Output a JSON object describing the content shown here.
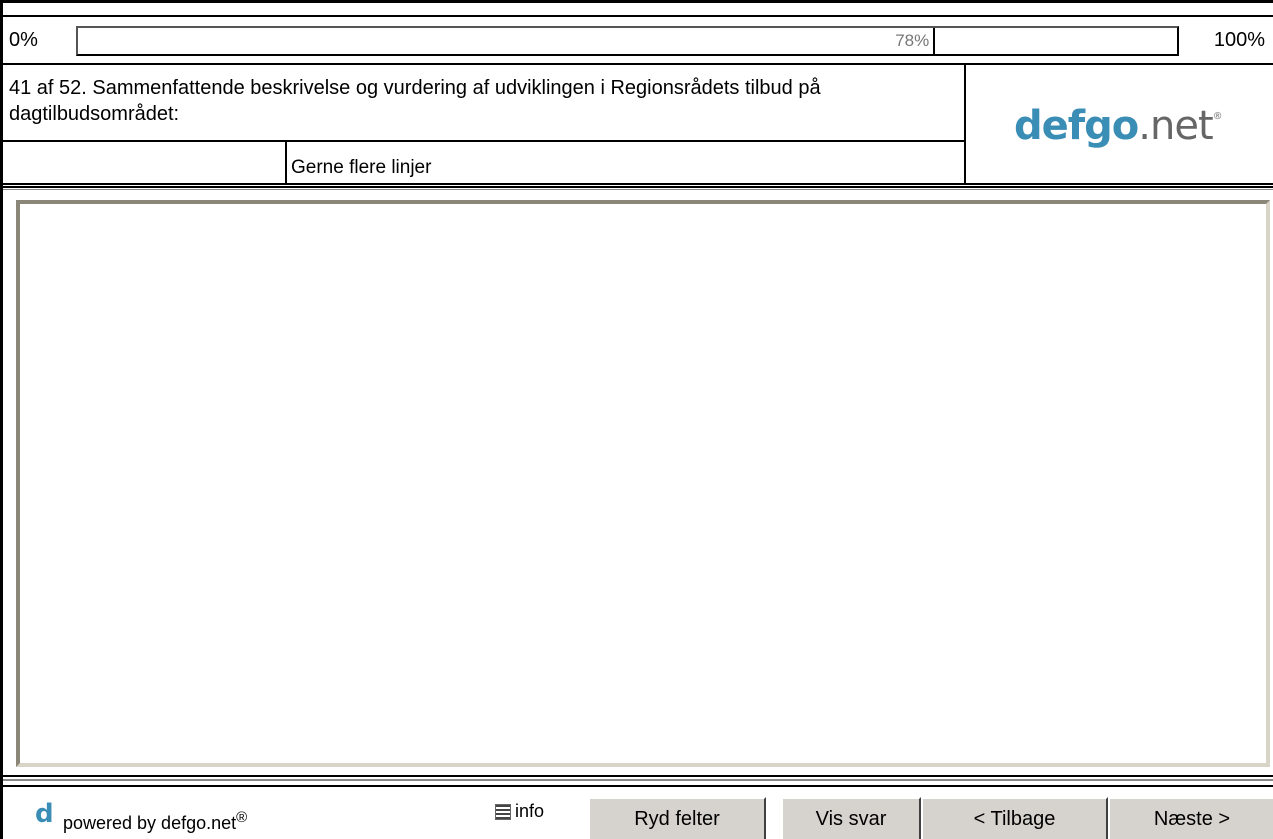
{
  "progress": {
    "start_label": "0%",
    "end_label": "100%",
    "value_label": "78%",
    "fraction": 0.78
  },
  "question": {
    "text": "41 af 52. Sammenfattende beskrivelse og vurdering af udviklingen i Regionsrådets tilbud på dagtilbudsområdet:",
    "hint": "Gerne flere linjer"
  },
  "logo": {
    "part1": "defgo",
    "part2": ".net",
    "reg": "®"
  },
  "answer": {
    "value": ""
  },
  "footer": {
    "d_logo": "d",
    "powered_text": "powered by defgo.net",
    "powered_reg": "®",
    "info_label": "info",
    "clear_label": "Ryd felter",
    "show_label": "Vis svar",
    "back_label": "< Tilbage",
    "next_label": "Næste >"
  },
  "colors": {
    "brand_blue": "#3a8db5",
    "button_face": "#d6d3ce"
  }
}
